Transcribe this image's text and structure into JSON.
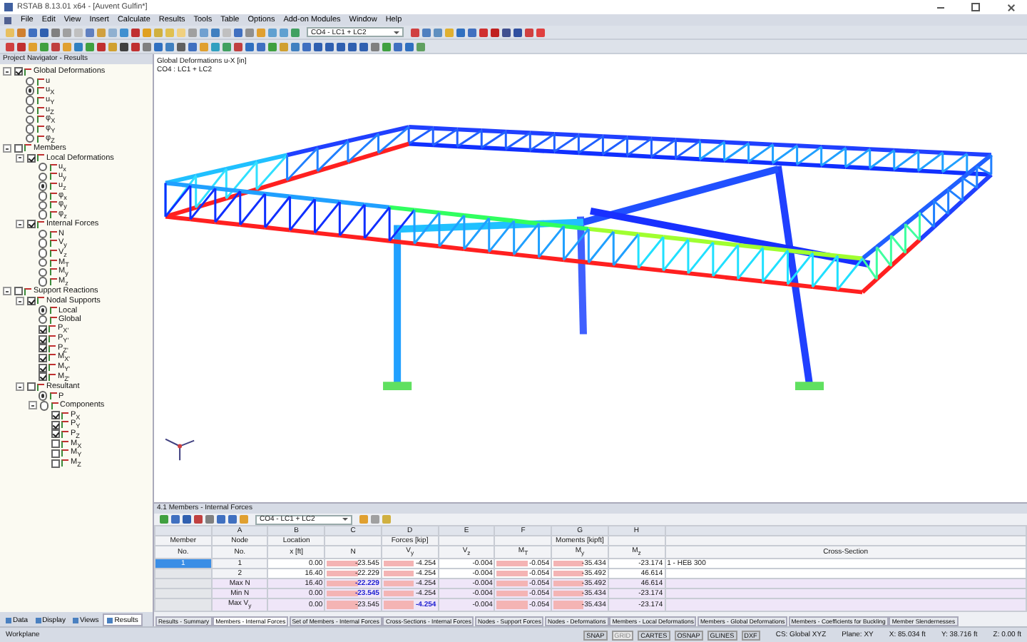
{
  "window": {
    "title": "RSTAB 8.13.01 x64 - [Auvent Gulfin*]"
  },
  "menu": [
    "File",
    "Edit",
    "View",
    "Insert",
    "Calculate",
    "Results",
    "Tools",
    "Table",
    "Options",
    "Add-on Modules",
    "Window",
    "Help"
  ],
  "toolbar": {
    "combo": "CO4 - LC1 + LC2"
  },
  "navigator": {
    "title": "Project Navigator - Results",
    "items": [
      {
        "label": "Global Deformations",
        "kind": "check",
        "checked": true,
        "expanded": true,
        "children": [
          {
            "label": "u",
            "kind": "radio",
            "selected": false
          },
          {
            "label": "u$_{X}$",
            "kind": "radio",
            "selected": true
          },
          {
            "label": "u$_{Y}$",
            "kind": "radio",
            "selected": false
          },
          {
            "label": "u$_{Z}$",
            "kind": "radio",
            "selected": false
          },
          {
            "label": "φ$_{X}$",
            "kind": "radio",
            "selected": false
          },
          {
            "label": "φ$_{Y}$",
            "kind": "radio",
            "selected": false
          },
          {
            "label": "φ$_{Z}$",
            "kind": "radio",
            "selected": false
          }
        ]
      },
      {
        "label": "Members",
        "kind": "check",
        "checked": false,
        "expanded": true,
        "children": [
          {
            "label": "Local Deformations",
            "kind": "check",
            "checked": true,
            "expanded": true,
            "children": [
              {
                "label": "u$_{x}$",
                "kind": "radio",
                "selected": false
              },
              {
                "label": "u$_{y}$",
                "kind": "radio",
                "selected": false
              },
              {
                "label": "u$_{z}$",
                "kind": "radio",
                "selected": true
              },
              {
                "label": "φ$_{x}$",
                "kind": "radio",
                "selected": false
              },
              {
                "label": "φ$_{y}$",
                "kind": "radio",
                "selected": false
              },
              {
                "label": "φ$_{z}$",
                "kind": "radio",
                "selected": false
              }
            ]
          },
          {
            "label": "Internal Forces",
            "kind": "check",
            "checked": true,
            "expanded": true,
            "children": [
              {
                "label": "N",
                "kind": "radio",
                "selected": false
              },
              {
                "label": "V$_{y}$",
                "kind": "radio",
                "selected": false
              },
              {
                "label": "V$_{z}$",
                "kind": "radio",
                "selected": false
              },
              {
                "label": "M$_{T}$",
                "kind": "radio",
                "selected": false
              },
              {
                "label": "M$_{y}$",
                "kind": "radio",
                "selected": false
              },
              {
                "label": "M$_{z}$",
                "kind": "radio",
                "selected": false
              }
            ]
          }
        ]
      },
      {
        "label": "Support Reactions",
        "kind": "check",
        "checked": false,
        "expanded": true,
        "children": [
          {
            "label": "Nodal Supports",
            "kind": "check",
            "checked": true,
            "expanded": true,
            "children": [
              {
                "label": "Local",
                "kind": "radio",
                "selected": true
              },
              {
                "label": "Global",
                "kind": "radio",
                "selected": false
              },
              {
                "label": "P$_{X'}$",
                "kind": "check",
                "checked": true
              },
              {
                "label": "P$_{Y'}$",
                "kind": "check",
                "checked": true
              },
              {
                "label": "P$_{Z'}$",
                "kind": "check",
                "checked": true
              },
              {
                "label": "M$_{X'}$",
                "kind": "check",
                "checked": true
              },
              {
                "label": "M$_{Y'}$",
                "kind": "check",
                "checked": true
              },
              {
                "label": "M$_{Z'}$",
                "kind": "check",
                "checked": true
              }
            ]
          },
          {
            "label": "Resultant",
            "kind": "check",
            "checked": false,
            "expanded": true,
            "children": [
              {
                "label": "P",
                "kind": "radio",
                "selected": true
              },
              {
                "label": "Components",
                "kind": "radio",
                "selected": false,
                "expanded": true,
                "children": [
                  {
                    "label": "P$_{X}$",
                    "kind": "check",
                    "checked": true
                  },
                  {
                    "label": "P$_{Y}$",
                    "kind": "check",
                    "checked": true
                  },
                  {
                    "label": "P$_{Z}$",
                    "kind": "check",
                    "checked": true
                  },
                  {
                    "label": "M$_{X}$",
                    "kind": "check",
                    "checked": false
                  },
                  {
                    "label": "M$_{Y}$",
                    "kind": "check",
                    "checked": false
                  },
                  {
                    "label": "M$_{Z}$",
                    "kind": "check",
                    "checked": false
                  }
                ]
              }
            ]
          }
        ]
      }
    ],
    "tabs": [
      {
        "label": "Data",
        "selected": false
      },
      {
        "label": "Display",
        "selected": false
      },
      {
        "label": "Views",
        "selected": false
      },
      {
        "label": "Results",
        "selected": true
      }
    ]
  },
  "viewport": {
    "caption": [
      "Global Deformations u-X [in]",
      "CO4 : LC1 + LC2"
    ]
  },
  "table": {
    "title": "4.1 Members - Internal Forces",
    "combo": "CO4 - LC1 + LC2",
    "columns": [
      {
        "top": "Member",
        "sub": "No."
      },
      {
        "letter": "A",
        "top": "Node",
        "sub": "No."
      },
      {
        "letter": "B",
        "top": "Location",
        "sub": "x [ft]"
      },
      {
        "letter": "C",
        "sub": "N",
        "bars": true
      },
      {
        "letter": "D",
        "top": "Forces [kip]",
        "sub": "V$_{y}$",
        "bars": true
      },
      {
        "letter": "E",
        "sub": "V$_{z}$",
        "bars": false
      },
      {
        "letter": "F",
        "sub": "M$_{T}$",
        "bars": true
      },
      {
        "letter": "G",
        "top": "Moments [kipft]",
        "sub": "M$_{y}$",
        "bars": true
      },
      {
        "letter": "H",
        "sub": "M$_{z}$",
        "bars": false
      },
      {
        "sub": "Cross-Section"
      }
    ],
    "rows": [
      {
        "kind": "member",
        "selected": true,
        "cells": [
          "1",
          "1",
          "0.00",
          "-23.545",
          "-4.254",
          "-0.004",
          "-0.054",
          "-35.434",
          "-23.174",
          "1 - HEB 300"
        ]
      },
      {
        "kind": "member",
        "selected": false,
        "cells": [
          null,
          "2",
          "16.40",
          "-22.229",
          "-4.254",
          "-0.004",
          "-0.054",
          "-35.492",
          "46.614",
          null
        ]
      },
      {
        "kind": "summary",
        "selected": false,
        "cells": [
          null,
          "Max N",
          "16.40",
          {
            "text": "-22.229",
            "emphasized": true
          },
          "-4.254",
          "-0.004",
          "-0.054",
          "-35.492",
          "46.614",
          null
        ]
      },
      {
        "kind": "summary",
        "selected": false,
        "cells": [
          null,
          "Min N",
          "0.00",
          {
            "text": "-23.545",
            "emphasized": true
          },
          "-4.254",
          "-0.004",
          "-0.054",
          "-35.434",
          "-23.174",
          null
        ]
      },
      {
        "kind": "summary",
        "selected": false,
        "cells": [
          null,
          "Max V$_{y}$",
          "0.00",
          "-23.545",
          {
            "text": "-4.254",
            "emphasized": true
          },
          "-0.004",
          "-0.054",
          "-35.434",
          "-23.174",
          null
        ]
      }
    ],
    "tabs": [
      {
        "label": "Results - Summary",
        "selected": false
      },
      {
        "label": "Members - Internal Forces",
        "selected": true
      },
      {
        "label": "Set of Members - Internal Forces",
        "selected": false
      },
      {
        "label": "Cross-Sections - Internal Forces",
        "selected": false
      },
      {
        "label": "Nodes - Support Forces",
        "selected": false
      },
      {
        "label": "Nodes - Deformations",
        "selected": false
      },
      {
        "label": "Members - Local Deformations",
        "selected": false
      },
      {
        "label": "Members - Global Deformations",
        "selected": false
      },
      {
        "label": "Members - Coefficients for Buckling",
        "selected": false
      },
      {
        "label": "Member Slendernesses",
        "selected": false
      }
    ]
  },
  "status_bar": {
    "left": "Workplane",
    "toggles": [
      {
        "label": "SNAP",
        "on": true
      },
      {
        "label": "GRID",
        "on": false
      },
      {
        "label": "CARTES",
        "on": true
      },
      {
        "label": "OSNAP",
        "on": true
      },
      {
        "label": "GLINES",
        "on": true
      },
      {
        "label": "DXF",
        "on": true
      }
    ],
    "fields": [
      "CS: Global XYZ",
      "Plane: XY",
      "X: 85.034 ft",
      "Y: 38.716 ft",
      "Z: 0.00 ft"
    ]
  }
}
